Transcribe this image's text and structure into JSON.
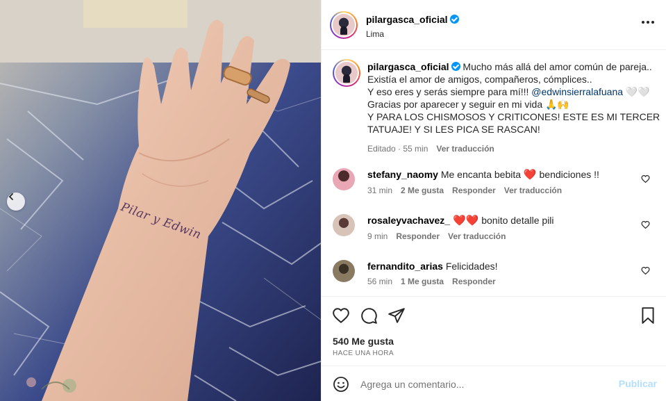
{
  "post": {
    "author": "pilargasca_oficial",
    "location": "Lima",
    "tattoo_text": "Pilar y Edwin",
    "caption_lines": [
      "Mucho más allá del amor común de pareja..",
      "Existía el amor de amigos, compañeros, cómplices..",
      "Y eso eres y serás siempre para mí!!!",
      "Gracias por aparecer y seguir en mi vida 🙏🙌",
      "Y PARA LOS CHISMOSOS Y CRITICONES! ESTE ES MI TERCER",
      "TATUAJE! Y SI LES PICA SE RASCAN!"
    ],
    "caption_mention": "@edwinsierralafuana",
    "caption_mention_suffix": "🤍🤍",
    "caption_edited": "Editado · 55 min",
    "translate_label": "Ver traducción",
    "likes": "540 Me gusta",
    "time_ago": "Hace una hora"
  },
  "comments": [
    {
      "user": "stefany_naomy",
      "text_before": "Me encanta bebita",
      "emoji": "❤️",
      "text_after": "bendiciones !!",
      "time": "31 min",
      "likes": "2 Me gusta",
      "reply": "Responder",
      "translate": "Ver traducción",
      "avatar_color": "#e9a7b5"
    },
    {
      "user": "rosaleyvachavez_",
      "text_before": "",
      "emoji": "❤️❤️",
      "text_after": "bonito detalle pili",
      "time": "9 min",
      "reply": "Responder",
      "translate": "Ver traducción",
      "avatar_color": "#d8c3b8"
    },
    {
      "user": "fernandito_arias",
      "text_before": "Felicidades!",
      "emoji": "",
      "text_after": "",
      "time": "56 min",
      "likes": "1 Me gusta",
      "reply": "Responder",
      "avatar_color": "#8a7a62"
    }
  ],
  "comment_box": {
    "placeholder": "Agrega un comentario...",
    "publish": "Publicar"
  },
  "colors": {
    "verified": "#0095f6",
    "link": "#00376b",
    "muted": "#737373",
    "publish_disabled": "#b2dffc"
  },
  "icons": [
    "chevron-left-icon",
    "verified-badge-icon",
    "more-options-icon",
    "heart-icon",
    "comment-icon",
    "share-icon",
    "bookmark-icon",
    "emoji-icon"
  ]
}
